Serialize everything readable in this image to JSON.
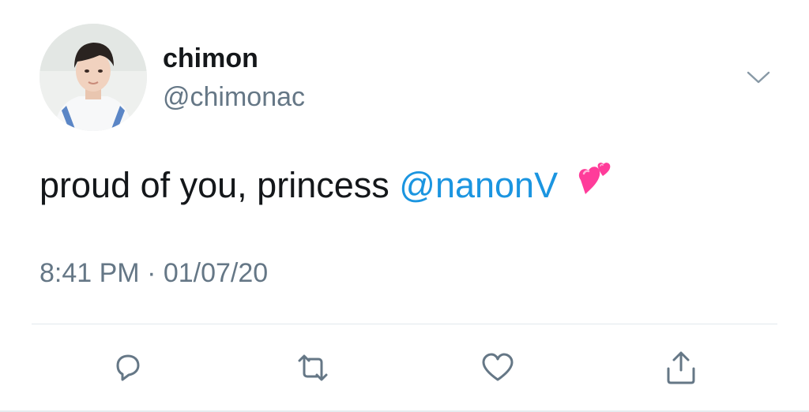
{
  "tweet": {
    "display_name": "chimon",
    "handle": "@chimonac",
    "text": "proud of you, princess ",
    "mention": "@nanonV",
    "emoji": "two-hearts-emoji",
    "timestamp": "8:41 PM · 01/07/20"
  },
  "icons": {
    "more": "chevron-down-icon",
    "reply": "reply-icon",
    "retweet": "retweet-icon",
    "like": "heart-icon",
    "share": "share-icon"
  },
  "colors": {
    "text": "#14171a",
    "secondary": "#657786",
    "link": "#1b95e0",
    "divider": "#e1e8ed",
    "emoji_pink": "#ff3c9a"
  }
}
